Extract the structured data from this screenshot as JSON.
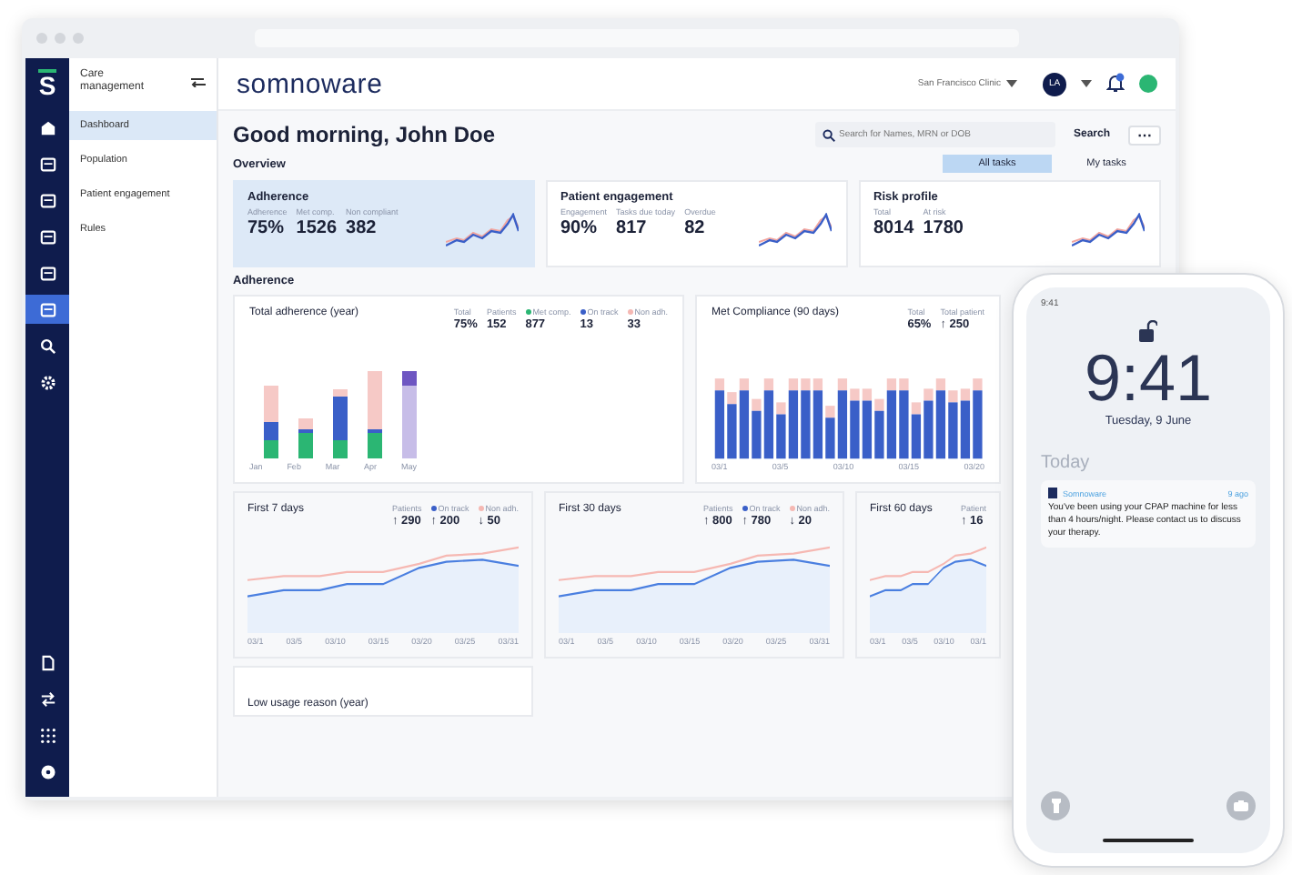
{
  "rail": {
    "logo": "S",
    "top_items": [
      {
        "kind": "home",
        "selected": false
      },
      {
        "kind": "panel",
        "selected": false
      },
      {
        "kind": "panel",
        "selected": false
      },
      {
        "kind": "panel",
        "selected": false
      },
      {
        "kind": "panel",
        "selected": false
      },
      {
        "kind": "panel",
        "selected": true
      },
      {
        "kind": "search",
        "selected": false
      },
      {
        "kind": "settings",
        "selected": false
      }
    ],
    "bottom_items": [
      {
        "kind": "document",
        "selected": false
      },
      {
        "kind": "swap",
        "selected": false
      },
      {
        "kind": "grid",
        "selected": false
      },
      {
        "kind": "help",
        "selected": false
      }
    ]
  },
  "sidebar": {
    "title": "Care management",
    "items": [
      {
        "label": "Dashboard",
        "selected": true
      },
      {
        "label": "Population",
        "selected": false
      },
      {
        "label": "Patient engagement",
        "selected": false
      },
      {
        "label": "Rules",
        "selected": false
      }
    ]
  },
  "header": {
    "logo": "somnoware",
    "clinic": "San Francisco Clinic",
    "avatar": "LA"
  },
  "greeting": "Good morning, John Doe",
  "search": {
    "placeholder": "Search for Names, MRN or DOB",
    "button": "Search",
    "more": "⋯"
  },
  "overview": {
    "label": "Overview",
    "tabs": [
      {
        "label": "All tasks",
        "selected": true
      },
      {
        "label": "My tasks",
        "selected": false
      }
    ],
    "cards": [
      {
        "title": "Adherence",
        "selected": true,
        "stats": [
          {
            "label": "Adherence",
            "value": "75%"
          },
          {
            "label": "Met comp.",
            "value": "1526"
          },
          {
            "label": "Non compliant",
            "value": "382"
          }
        ]
      },
      {
        "title": "Patient engagement",
        "selected": false,
        "stats": [
          {
            "label": "Engagement",
            "value": "90%"
          },
          {
            "label": "Tasks due today",
            "value": "817"
          },
          {
            "label": "Overdue",
            "value": "82"
          }
        ]
      },
      {
        "title": "Risk profile",
        "selected": false,
        "stats": [
          {
            "label": "Total",
            "value": "8014"
          },
          {
            "label": "At risk",
            "value": "1780"
          }
        ]
      }
    ]
  },
  "adherence": {
    "label": "Adherence",
    "charts": [
      {
        "kind": "stacked",
        "title": "Total adherence (year)",
        "stats": [
          {
            "label": "Total",
            "value": "75%"
          },
          {
            "label": "Patients",
            "value": "152"
          },
          {
            "label": "Met comp.",
            "value": "877",
            "color": "#2bb673"
          },
          {
            "label": "On track",
            "value": "13",
            "color": "#3a5fc8"
          },
          {
            "label": "Non adh.",
            "value": "33",
            "color": "#f5b8b3"
          }
        ],
        "x_labels": [
          "Jan",
          "Feb",
          "Mar",
          "Apr",
          "May"
        ]
      },
      {
        "kind": "compliance",
        "title": "Met Compliance (90 days)",
        "stats": [
          {
            "label": "Total",
            "value": "65%"
          },
          {
            "label": "Total patient",
            "value": "↑ 250"
          }
        ],
        "x_labels": [
          "03/1",
          "03/5",
          "03/10",
          "03/15",
          "03/20"
        ]
      }
    ],
    "trends": [
      {
        "title": "First 7 days",
        "stats": [
          {
            "label": "Patients",
            "value": "↑ 290"
          },
          {
            "label": "On track",
            "value": "↑ 200",
            "color": "#3a5fc8"
          },
          {
            "label": "Non adh.",
            "value": "↓ 50",
            "color": "#f5b8b3"
          }
        ],
        "x_labels": [
          "03/1",
          "03/5",
          "03/10",
          "03/15",
          "03/20",
          "03/25",
          "03/31"
        ]
      },
      {
        "title": "First 30 days",
        "stats": [
          {
            "label": "Patients",
            "value": "↑ 800"
          },
          {
            "label": "On track",
            "value": "↑ 780",
            "color": "#3a5fc8"
          },
          {
            "label": "Non adh.",
            "value": "↓ 20",
            "color": "#f5b8b3"
          }
        ],
        "x_labels": [
          "03/1",
          "03/5",
          "03/10",
          "03/15",
          "03/20",
          "03/25",
          "03/31"
        ]
      },
      {
        "title": "First 60 days",
        "stats": [
          {
            "label": "Patient",
            "value": "↑ 16"
          }
        ],
        "x_labels": [
          "03/1",
          "03/5",
          "03/10",
          "03/1"
        ]
      }
    ],
    "low_usage": {
      "title": "Low usage reason (year)"
    }
  },
  "phone": {
    "status_time": "9:41",
    "clock": "9:41",
    "date": "Tuesday, 9 June",
    "section": "Today",
    "notification": {
      "app": "Somnoware",
      "time": "9 ago",
      "text": "You've been using your CPAP machine for less than 4 hours/night. Please contact us to discuss your therapy."
    }
  }
}
